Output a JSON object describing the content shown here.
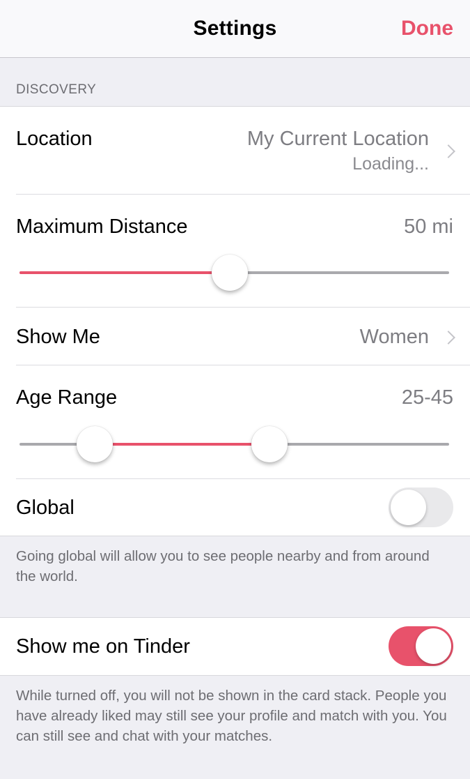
{
  "navbar": {
    "title": "Settings",
    "done_label": "Done"
  },
  "colors": {
    "accent": "#e8526b",
    "background": "#efeff4",
    "secondary_text": "#7d7d82"
  },
  "discovery": {
    "section_header": "DISCOVERY",
    "location": {
      "label": "Location",
      "value": "My Current Location",
      "status": "Loading...",
      "icon": "chevron-right-icon"
    },
    "max_distance": {
      "label": "Maximum Distance",
      "value": "50 mi",
      "slider_fraction": 0.49
    },
    "show_me": {
      "label": "Show Me",
      "value": "Women",
      "icon": "chevron-right-icon"
    },
    "age_range": {
      "label": "Age Range",
      "value": "25-45",
      "low_fraction": 0.175,
      "high_fraction": 0.582
    },
    "global": {
      "label": "Global",
      "enabled": false,
      "footer": "Going global will allow you to see people nearby and from around the world."
    }
  },
  "visibility": {
    "show_me_on_tinder": {
      "label": "Show me on Tinder",
      "enabled": true,
      "footer": "While turned off, you will not be shown in the card stack. People you have already liked may still see your profile and match with you. You can still see and chat with your matches."
    }
  }
}
